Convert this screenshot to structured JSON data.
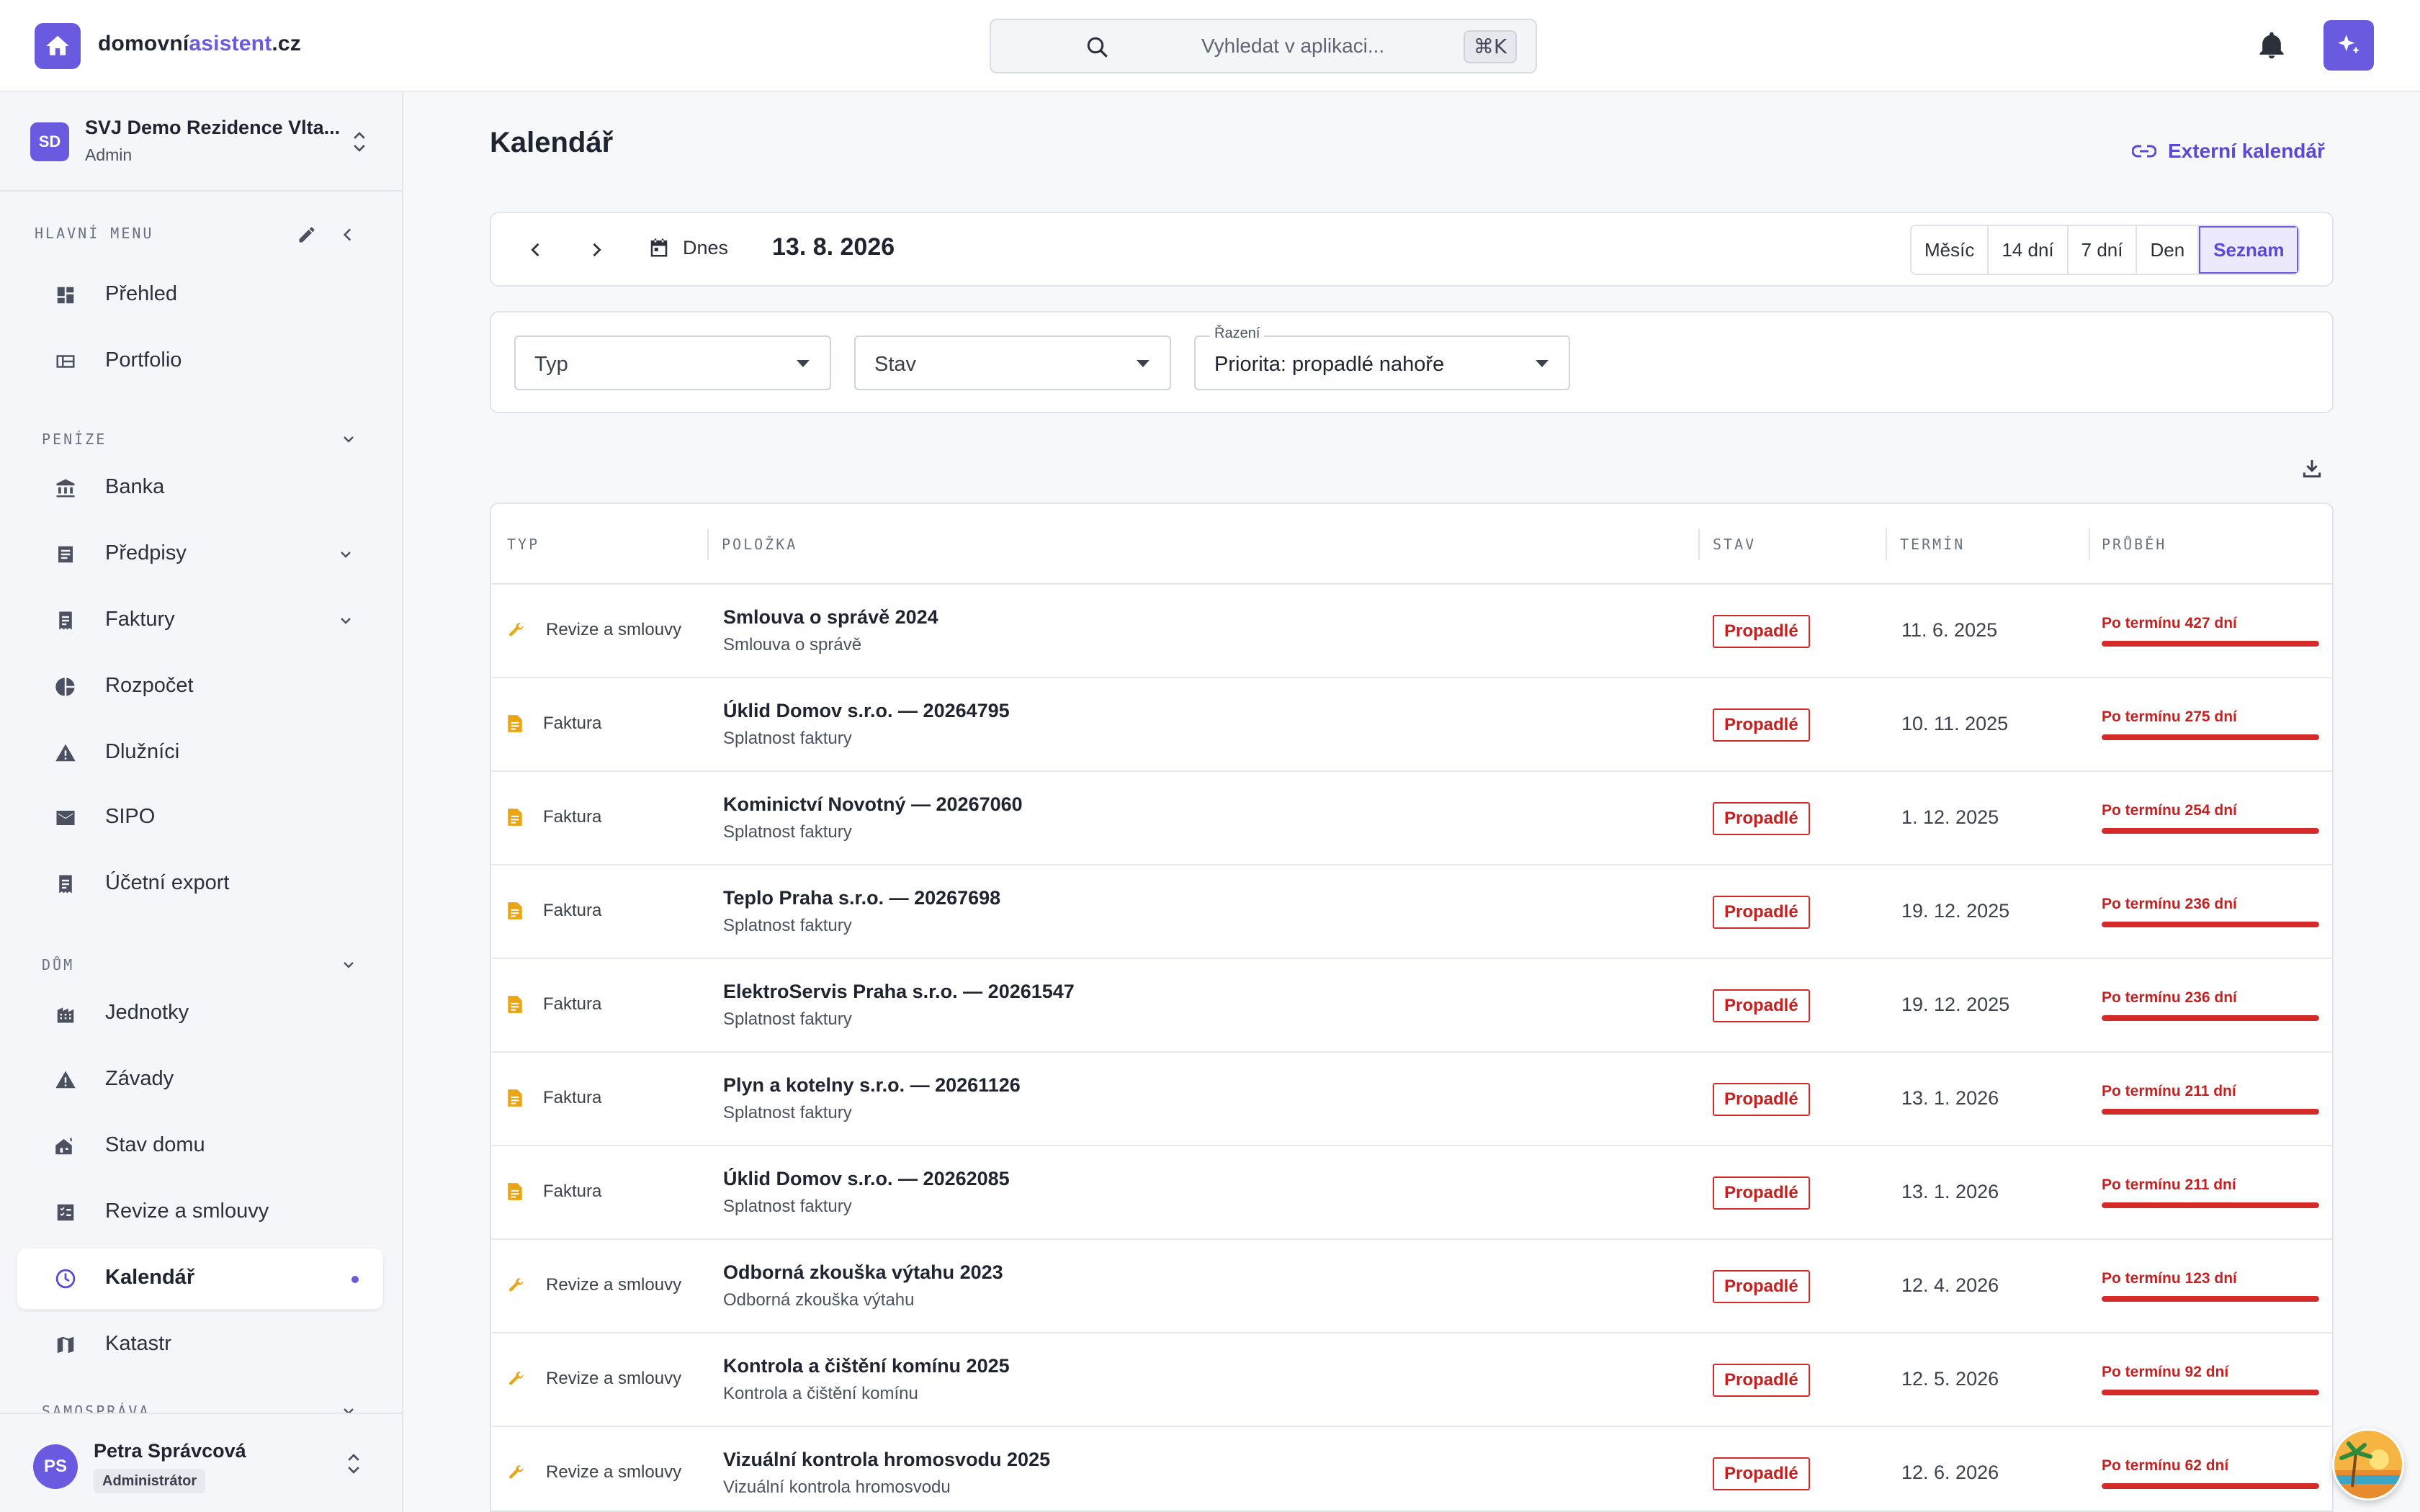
{
  "brand": {
    "prefix": "domovní",
    "accent": "asistent",
    "suffix": ".cz"
  },
  "search": {
    "placeholder": "Vyhledat v aplikaci...",
    "shortcut": "⌘K"
  },
  "org": {
    "initials": "SD",
    "name": "SVJ Demo Rezidence Vlta...",
    "role": "Admin"
  },
  "sidebar": {
    "main_label": "HLAVNÍ MENU",
    "money_label": "PENÍZE",
    "house_label": "DŮM",
    "gov_label": "SAMOSPRÁVA",
    "items": {
      "prehled": "Přehled",
      "portfolio": "Portfolio",
      "banka": "Banka",
      "predpisy": "Předpisy",
      "faktury": "Faktury",
      "rozpocet": "Rozpočet",
      "dluznici": "Dlužníci",
      "sipo": "SIPO",
      "ucetni": "Účetní export",
      "jednotky": "Jednotky",
      "zavady": "Závady",
      "stav": "Stav domu",
      "revize": "Revize a smlouvy",
      "kalendar": "Kalendář",
      "katastr": "Katastr"
    }
  },
  "user": {
    "initials": "PS",
    "name": "Petra Správcová",
    "role": "Administrátor"
  },
  "page": {
    "title": "Kalendář",
    "external": "Externí kalendář"
  },
  "toolbar": {
    "today": "Dnes",
    "date": "13. 8. 2026",
    "views": [
      "Měsíc",
      "14 dní",
      "7 dní",
      "Den",
      "Seznam"
    ],
    "active_view": "Seznam"
  },
  "filters": {
    "type": "Typ",
    "state": "Stav",
    "sort_label": "Řazení",
    "sort_value": "Priorita: propadlé nahoře"
  },
  "table": {
    "headers": {
      "typ": "TYP",
      "polozka": "POLOŽKA",
      "stav": "STAV",
      "termin": "TERMÍN",
      "prubeh": "PRŮBĚH"
    },
    "rows": [
      {
        "type": "Revize a smlouvy",
        "icon": "wrench-icon",
        "title": "Smlouva o správě 2024",
        "sub": "Smlouva o správě",
        "status": "Propadlé",
        "due": "11. 6. 2025",
        "progress": "Po termínu 427 dní"
      },
      {
        "type": "Faktura",
        "icon": "invoice-icon",
        "title": "Úklid Domov s.r.o. — 20264795",
        "sub": "Splatnost faktury",
        "status": "Propadlé",
        "due": "10. 11. 2025",
        "progress": "Po termínu 275 dní"
      },
      {
        "type": "Faktura",
        "icon": "invoice-icon",
        "title": "Kominictví Novotný — 20267060",
        "sub": "Splatnost faktury",
        "status": "Propadlé",
        "due": "1. 12. 2025",
        "progress": "Po termínu 254 dní"
      },
      {
        "type": "Faktura",
        "icon": "invoice-icon",
        "title": "Teplo Praha s.r.o. — 20267698",
        "sub": "Splatnost faktury",
        "status": "Propadlé",
        "due": "19. 12. 2025",
        "progress": "Po termínu 236 dní"
      },
      {
        "type": "Faktura",
        "icon": "invoice-icon",
        "title": "ElektroServis Praha s.r.o. — 20261547",
        "sub": "Splatnost faktury",
        "status": "Propadlé",
        "due": "19. 12. 2025",
        "progress": "Po termínu 236 dní"
      },
      {
        "type": "Faktura",
        "icon": "invoice-icon",
        "title": "Plyn a kotelny s.r.o. — 20261126",
        "sub": "Splatnost faktury",
        "status": "Propadlé",
        "due": "13. 1. 2026",
        "progress": "Po termínu 211 dní"
      },
      {
        "type": "Faktura",
        "icon": "invoice-icon",
        "title": "Úklid Domov s.r.o. — 20262085",
        "sub": "Splatnost faktury",
        "status": "Propadlé",
        "due": "13. 1. 2026",
        "progress": "Po termínu 211 dní"
      },
      {
        "type": "Revize a smlouvy",
        "icon": "wrench-icon",
        "title": "Odborná zkouška výtahu 2023",
        "sub": "Odborná zkouška výtahu",
        "status": "Propadlé",
        "due": "12. 4. 2026",
        "progress": "Po termínu 123 dní"
      },
      {
        "type": "Revize a smlouvy",
        "icon": "wrench-icon",
        "title": "Kontrola a čištění komínu 2025",
        "sub": "Kontrola a čištění komínu",
        "status": "Propadlé",
        "due": "12. 5. 2026",
        "progress": "Po termínu 92 dní"
      },
      {
        "type": "Revize a smlouvy",
        "icon": "wrench-icon",
        "title": "Vizuální kontrola hromosvodu 2025",
        "sub": "Vizuální kontrola hromosvodu",
        "status": "Propadlé",
        "due": "12. 6. 2026",
        "progress": "Po termínu 62 dní"
      }
    ]
  },
  "colors": {
    "accent": "#6a5ae0",
    "danger": "#d42a2a",
    "warning_icon": "#e9a516"
  }
}
